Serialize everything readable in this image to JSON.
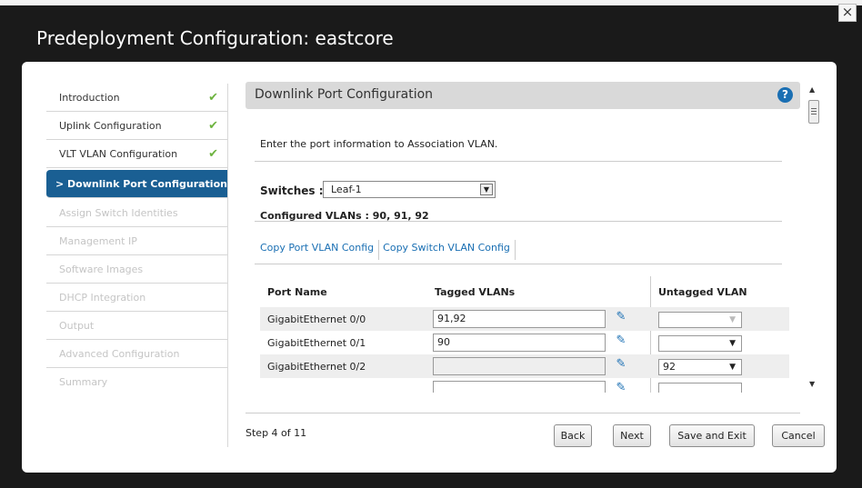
{
  "window": {
    "title": "Predeployment Configuration: eastcore",
    "close_label": "×"
  },
  "sidebar": {
    "items": [
      {
        "label": "Introduction",
        "state": "done"
      },
      {
        "label": "Uplink Configuration",
        "state": "done"
      },
      {
        "label": "VLT VLAN Configuration",
        "state": "done"
      },
      {
        "label": "> Downlink Port Configuration",
        "state": "active"
      },
      {
        "label": "Assign Switch Identities",
        "state": "disabled"
      },
      {
        "label": "Management IP",
        "state": "disabled"
      },
      {
        "label": "Software Images",
        "state": "disabled"
      },
      {
        "label": "DHCP Integration",
        "state": "disabled"
      },
      {
        "label": "Output",
        "state": "disabled"
      },
      {
        "label": "Advanced Configuration",
        "state": "disabled"
      },
      {
        "label": "Summary",
        "state": "disabled"
      }
    ],
    "check_glyph": "✔"
  },
  "panel": {
    "title": "Downlink Port Configuration",
    "help_glyph": "?",
    "intro": "Enter the port information to Association VLAN.",
    "switch_label": "Switches :",
    "switch_value": "Leaf-1",
    "configured_vlans": "Configured VLANs : 90, 91, 92",
    "tabs": [
      "Copy Port VLAN Config",
      "Copy Switch VLAN Config"
    ]
  },
  "table": {
    "headers": {
      "port": "Port Name",
      "tagged": "Tagged VLANs",
      "untagged": "Untagged VLAN"
    },
    "rows": [
      {
        "port": "GigabitEthernet 0/0",
        "tagged": "91,92",
        "untagged": ""
      },
      {
        "port": "GigabitEthernet 0/1",
        "tagged": "90",
        "untagged": ""
      },
      {
        "port": "GigabitEthernet 0/2",
        "tagged": "",
        "untagged": "92"
      },
      {
        "port": "",
        "tagged": "",
        "untagged": ""
      }
    ]
  },
  "footer": {
    "step": "Step 4 of 11",
    "back": "Back",
    "next": "Next",
    "save_exit": "Save and Exit",
    "cancel": "Cancel"
  },
  "colors": {
    "active_step": "#1a5f93",
    "check": "#6db33f",
    "link": "#1a6fb3",
    "header_bg": "#d9d9d9"
  }
}
